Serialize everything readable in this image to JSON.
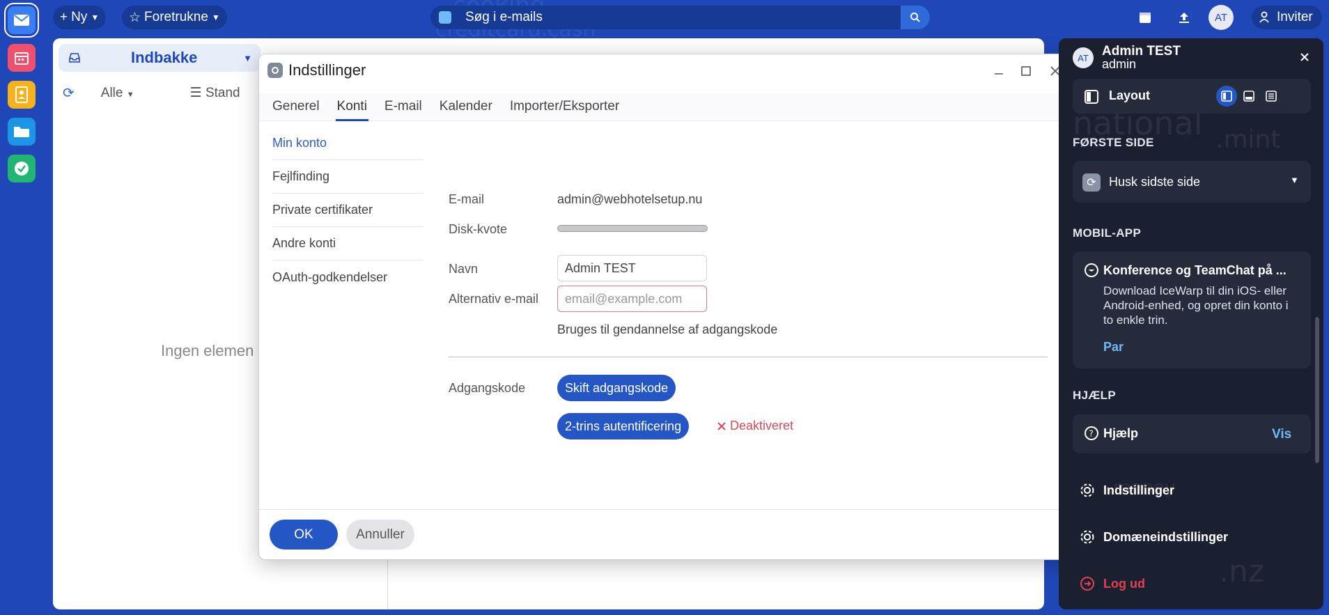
{
  "rail": {
    "apps": [
      {
        "name": "mail",
        "color": "#3b7ef2"
      },
      {
        "name": "calendar",
        "color": "#f0506e"
      },
      {
        "name": "contacts",
        "color": "#f6b21c"
      },
      {
        "name": "files",
        "color": "#1b95e6"
      },
      {
        "name": "tasks",
        "color": "#22b573"
      }
    ]
  },
  "topbar": {
    "new_label": "Ny",
    "favorites_label": "Foretrukne",
    "search_placeholder": "Søg i e-mails",
    "avatar_initials": "AT",
    "invite_label": "Inviter"
  },
  "mail": {
    "folder": "Indbakke",
    "filter": "Alle",
    "view": "Stand",
    "empty_text": "Ingen elemen"
  },
  "dialog": {
    "title": "Indstillinger",
    "tabs": [
      "Generel",
      "Konti",
      "E-mail",
      "Kalender",
      "Importer/Eksporter"
    ],
    "active_tab": "Konti",
    "nav": [
      "Min konto",
      "Fejlfinding",
      "Private certifikater",
      "Andre konti",
      "OAuth-godkendelser"
    ],
    "active_nav": "Min konto",
    "form": {
      "email_label": "E-mail",
      "email_value": "admin@webhotelsetup.nu",
      "quota_label": "Disk-kvote",
      "quota_used_fraction": 0,
      "name_label": "Navn",
      "name_value": "Admin TEST",
      "alt_email_label": "Alternativ e-mail",
      "alt_email_placeholder": "email@example.com",
      "alt_email_hint": "Bruges til gendannelse af adgangskode",
      "password_label": "Adgangskode",
      "change_password": "Skift adgangskode",
      "two_factor": "2-trins autentificering",
      "two_factor_status": "Deaktiveret"
    },
    "ok_label": "OK",
    "cancel_label": "Annuller"
  },
  "profile": {
    "initials": "AT",
    "name": "Admin TEST",
    "role": "admin",
    "layout_label": "Layout",
    "first_page_section": "FØRSTE SIDE",
    "first_page_value": "Husk sidste side",
    "mobile_section": "MOBIL-APP",
    "mobile_title": "Konference og TeamChat på ...",
    "mobile_desc": "Download IceWarp til din iOS- eller Android-enhed, og opret din konto i to enkle trin.",
    "mobile_link": "Par",
    "help_section": "HJÆLP",
    "help_label": "Hjælp",
    "help_link": "Vis",
    "settings_label": "Indstillinger",
    "domain_settings_label": "Domæneindstillinger",
    "logout_label": "Log ud"
  },
  "colors": {
    "accent": "#2457c5",
    "background": "#1f47b7",
    "danger": "#d94a5a"
  }
}
